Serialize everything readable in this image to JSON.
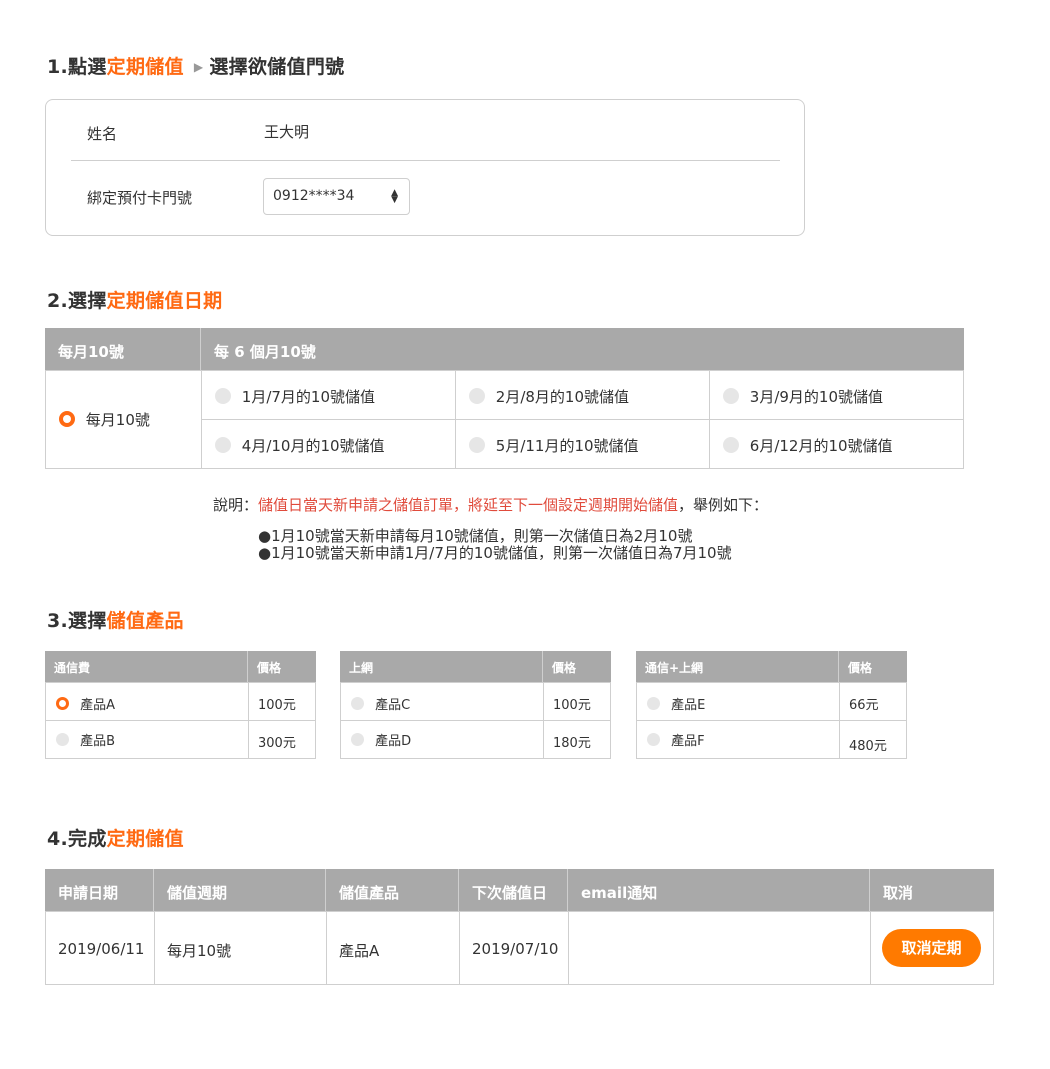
{
  "step1": {
    "prefix": "1.點選",
    "highlight": "定期儲值",
    "suffix": "選擇欲儲值門號",
    "name_label": "姓名",
    "name_value": "王大明",
    "card_label": "綁定預付卡門號",
    "phone_selected": "0912****34"
  },
  "step2": {
    "prefix": "2.選擇",
    "highlight": "定期儲值日期",
    "col_monthly": "每月10號",
    "col_six_month": "每 6 個月10號",
    "monthly_option": "每月10號",
    "six_month_options": [
      "1月/7月的10號儲值",
      "2月/8月的10號儲值",
      "3月/9月的10號儲值",
      "4月/10月的10號儲值",
      "5月/11月的10號儲值",
      "6月/12月的10號儲值"
    ],
    "note_prefix": "說明：",
    "note_highlight": "儲值日當天新申請之儲值訂單，將延至下一個設定週期開始儲值",
    "note_suffix": "，舉例如下：",
    "bullets": [
      "●1月10號當天新申請每月10號儲值，則第一次儲值日為2月10號",
      "●1月10號當天新申請1月/7月的10號儲值，則第一次儲值日為7月10號"
    ]
  },
  "step3": {
    "prefix": "3.選擇",
    "highlight": "儲值產品",
    "price_header": "價格",
    "groups": [
      {
        "title": "通信費",
        "items": [
          {
            "name": "產品A",
            "price": "100元"
          },
          {
            "name": "產品B",
            "price": "300元"
          }
        ]
      },
      {
        "title": "上網",
        "items": [
          {
            "name": "產品C",
            "price": "100元"
          },
          {
            "name": "產品D",
            "price": "180元"
          }
        ]
      },
      {
        "title": "通信+上網",
        "items": [
          {
            "name": "產品E",
            "price": "66元"
          },
          {
            "name": "產品F",
            "price": "480元"
          }
        ]
      }
    ]
  },
  "step4": {
    "prefix": "4.完成",
    "highlight": "定期儲值",
    "headers": [
      "申請日期",
      "儲值週期",
      "儲值產品",
      "下次儲值日",
      "email通知",
      "取消"
    ],
    "row": {
      "apply_date": "2019/06/11",
      "cycle": "每月10號",
      "product": "產品A",
      "next_date": "2019/07/10",
      "email": ""
    },
    "cancel_label": "取消定期"
  },
  "colors": {
    "accent": "#ff6a13",
    "header_bg": "#a9a9a9",
    "note_red": "#e04b3c",
    "button": "#ff7a00"
  }
}
